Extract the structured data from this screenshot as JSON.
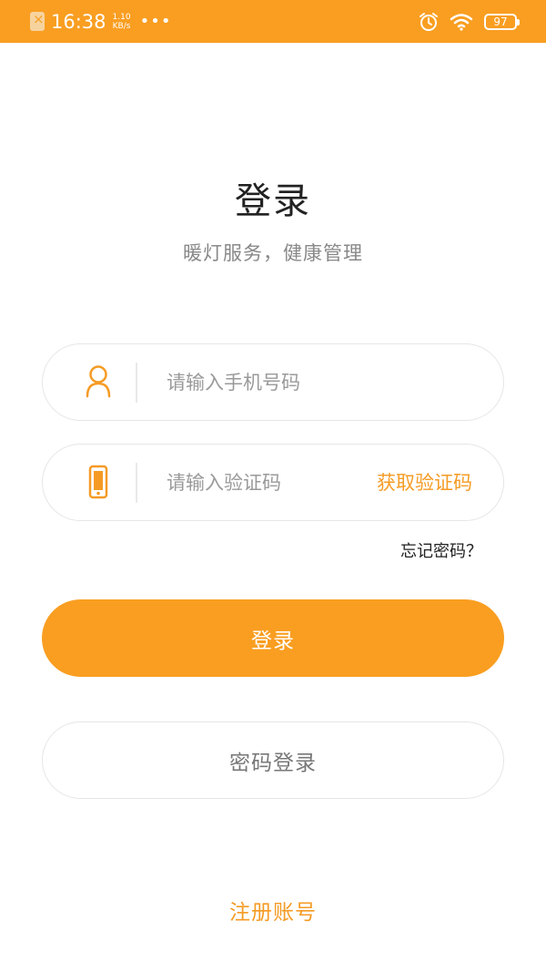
{
  "status_bar": {
    "time": "16:38",
    "net_speed_value": "1.10",
    "net_speed_unit": "KB/s",
    "more": "•••",
    "battery": "97",
    "icons": [
      "sim-off-icon",
      "alarm-icon",
      "wifi-icon",
      "battery-icon"
    ]
  },
  "page": {
    "title": "登录",
    "subtitle": "暖灯服务，健康管理"
  },
  "phone_field": {
    "icon": "user-icon",
    "placeholder": "请输入手机号码",
    "value": ""
  },
  "code_field": {
    "icon": "mobile-phone-icon",
    "placeholder": "请输入验证码",
    "value": "",
    "get_code_label": "获取验证码"
  },
  "forgot_password": "忘记密码？",
  "login_button": "登录",
  "password_login_button": "密码登录",
  "register_link": "注册账号",
  "colors": {
    "accent": "#f99e21",
    "accent_text": "#f59b24",
    "background": "#ffffff"
  }
}
